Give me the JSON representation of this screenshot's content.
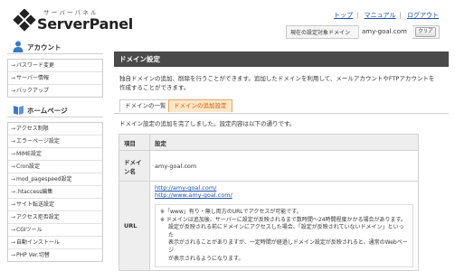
{
  "header": {
    "logo_sub": "サーバーパネル",
    "logo_main": "ServerPanel",
    "top_links": [
      "トップ",
      "マニュアル",
      "ログアウト"
    ],
    "domain_label": "現在の設定対象ドメイン",
    "domain_value": "amy-goal.com",
    "clear_button": "クリア"
  },
  "sidebar": {
    "account": {
      "title": "アカウント",
      "items": [
        "パスワード変更",
        "サーバー情報",
        "バックアップ"
      ]
    },
    "homepage": {
      "title": "ホームページ",
      "items": [
        "アクセス制限",
        "エラーページ設定",
        "MIME設定",
        "Cron設定",
        "mod_pagespeed設定",
        ".htaccess編集",
        "サイト転送設定",
        "アクセス拒否設定",
        "CGIツール",
        "自動インストール",
        "PHP Ver.切替"
      ]
    }
  },
  "main": {
    "title": "ドメイン設定",
    "intro_line1": "独自ドメインの追加、削除を行うことができます。追加したドメインを利用して、メールアカウントやFTPアカウントを",
    "intro_line2": "作成することができます。",
    "tabs": [
      "ドメインの一覧",
      "ドメインの追加設定"
    ],
    "done_message": "ドメイン設定の追加を完了しました。設定内容は以下の通りです。",
    "table": {
      "col1": "項目",
      "col2": "設定",
      "rows": [
        {
          "label": "ドメイン名",
          "value": "amy-goal.com"
        }
      ],
      "url_label": "URL",
      "urls": [
        "http://amy-goal.com/",
        "http://www.amy-goal.com/"
      ],
      "note1": "※「www」有り・無し両方のURLでアクセスが可能です。",
      "note2a": "※ ドメインは追加後、サーバーに設定が反映されるまで数時間～24時間程度かかる場合があります。",
      "note2b": "設定が反映される前にドメインにアクセスした場合、「設定が反映されていないドメイン」といった",
      "note2c": "表示がされることがありますが、一定時間が経過しドメイン設定が反映されると、通常のWebページ",
      "note2d": "が表示されるようになります。"
    }
  }
}
